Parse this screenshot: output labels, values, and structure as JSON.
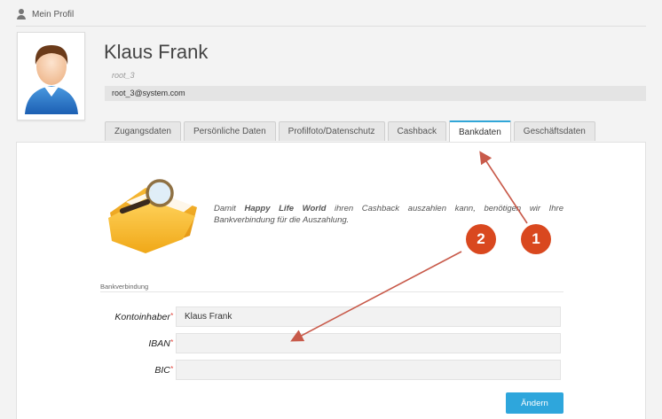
{
  "breadcrumb": {
    "label": "Mein Profil"
  },
  "profile": {
    "name": "Klaus Frank",
    "username": "root_3",
    "email": "root_3@system.com"
  },
  "tabs": [
    {
      "label": "Zugangsdaten",
      "active": false
    },
    {
      "label": "Persönliche Daten",
      "active": false
    },
    {
      "label": "Profilfoto/Datenschutz",
      "active": false
    },
    {
      "label": "Cashback",
      "active": false
    },
    {
      "label": "Bankdaten",
      "active": true
    },
    {
      "label": "Geschäftsdaten",
      "active": false
    }
  ],
  "info": {
    "text_before": "Damit ",
    "brand": "Happy Life World",
    "text_after": " ihren Cashback auszahlen kann, benötigen wir Ihre Bankverbindung für die Auszahlung."
  },
  "section": {
    "label": "Bankverbindung"
  },
  "form": {
    "kontoinhaber_label": "Kontoinhaber",
    "kontoinhaber_value": "Klaus Frank",
    "iban_label": "IBAN",
    "iban_value": "",
    "bic_label": "BIC",
    "bic_value": "",
    "required_mark": "*",
    "submit_label": "Ändern"
  },
  "annotations": {
    "marker_1": "1",
    "marker_2": "2",
    "color": "#d9481f"
  },
  "colors": {
    "accent": "#2ea6dc",
    "background": "#f3f3f3"
  }
}
